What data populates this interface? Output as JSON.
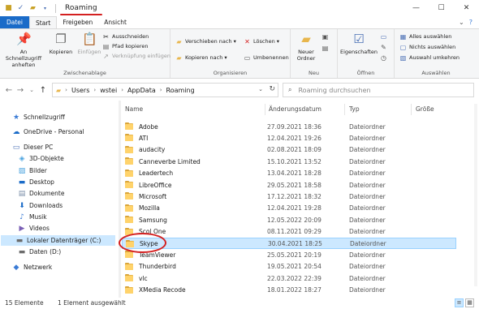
{
  "window": {
    "title": "Roaming",
    "controls": [
      "—",
      "☐",
      "✕"
    ]
  },
  "tabs": [
    {
      "label": "Datei"
    },
    {
      "label": "Start"
    },
    {
      "label": "Freigeben"
    },
    {
      "label": "Ansicht"
    }
  ],
  "ribbon": {
    "clipboard": {
      "pin_label": "An Schnellzugriff anheften",
      "copy_label": "Kopieren",
      "paste_label": "Einfügen",
      "cut_label": "Ausschneiden",
      "copy_path_label": "Pfad kopieren",
      "paste_shortcut_label": "Verknüpfung einfügen",
      "group_label": "Zwischenablage"
    },
    "organize": {
      "move_label": "Verschieben nach ▾",
      "delete_label": "Löschen ▾",
      "copy_to_label": "Kopieren nach ▾",
      "rename_label": "Umbenennen",
      "group_label": "Organisieren"
    },
    "new": {
      "new_folder_label": "Neuer Ordner",
      "group_label": "Neu"
    },
    "open": {
      "properties_label": "Eigenschaften",
      "group_label": "Öffnen"
    },
    "select": {
      "select_all_label": "Alles auswählen",
      "select_none_label": "Nichts auswählen",
      "invert_label": "Auswahl umkehren",
      "group_label": "Auswählen"
    }
  },
  "address": {
    "crumbs": [
      "Users",
      "wstei",
      "AppData",
      "Roaming"
    ],
    "search_placeholder": "Roaming durchsuchen"
  },
  "nav": {
    "items": [
      {
        "label": "Schnellzugriff",
        "icon": "star-icon"
      },
      {
        "label": "OneDrive - Personal",
        "icon": "cloud-icon"
      },
      {
        "label": "Dieser PC",
        "icon": "computer-icon"
      },
      {
        "label": "3D-Objekte",
        "icon": "cube-icon"
      },
      {
        "label": "Bilder",
        "icon": "pictures-icon"
      },
      {
        "label": "Desktop",
        "icon": "desktop-icon"
      },
      {
        "label": "Dokumente",
        "icon": "documents-icon"
      },
      {
        "label": "Downloads",
        "icon": "download-icon"
      },
      {
        "label": "Musik",
        "icon": "music-icon"
      },
      {
        "label": "Videos",
        "icon": "video-icon"
      },
      {
        "label": "Lokaler Datenträger (C:)",
        "icon": "drive-icon"
      },
      {
        "label": "Daten (D:)",
        "icon": "drive-icon"
      },
      {
        "label": "Netzwerk",
        "icon": "network-icon"
      }
    ]
  },
  "files": {
    "columns": [
      "Name",
      "Änderungsdatum",
      "Typ",
      "Größe"
    ],
    "rows": [
      {
        "name": "Adobe",
        "date": "27.09.2021 18:36",
        "type": "Dateiordner"
      },
      {
        "name": "ATI",
        "date": "12.04.2021 19:26",
        "type": "Dateiordner"
      },
      {
        "name": "audacity",
        "date": "02.08.2021 18:09",
        "type": "Dateiordner"
      },
      {
        "name": "Canneverbe Limited",
        "date": "15.10.2021 13:52",
        "type": "Dateiordner"
      },
      {
        "name": "Leadertech",
        "date": "13.04.2021 18:28",
        "type": "Dateiordner"
      },
      {
        "name": "LibreOffice",
        "date": "29.05.2021 18:58",
        "type": "Dateiordner"
      },
      {
        "name": "Microsoft",
        "date": "17.12.2021 18:32",
        "type": "Dateiordner"
      },
      {
        "name": "Mozilla",
        "date": "12.04.2021 19:28",
        "type": "Dateiordner"
      },
      {
        "name": "Samsung",
        "date": "12.05.2022 20:09",
        "type": "Dateiordner"
      },
      {
        "name": "Scol One",
        "date": "08.11.2021 09:29",
        "type": "Dateiordner"
      },
      {
        "name": "Skype",
        "date": "30.04.2021 18:25",
        "type": "Dateiordner"
      },
      {
        "name": "TeamViewer",
        "date": "25.05.2021 20:19",
        "type": "Dateiordner"
      },
      {
        "name": "Thunderbird",
        "date": "19.05.2021 20:54",
        "type": "Dateiordner"
      },
      {
        "name": "vlc",
        "date": "22.03.2022 22:39",
        "type": "Dateiordner"
      },
      {
        "name": "XMedia Recode",
        "date": "18.01.2022 18:27",
        "type": "Dateiordner"
      }
    ]
  },
  "status": {
    "count": "15 Elemente",
    "selection": "1 Element ausgewählt"
  },
  "colors": {
    "accent": "#1a6bc8",
    "selection": "#cce8ff",
    "annotation": "#d42020",
    "folder": "#ffd36b"
  }
}
